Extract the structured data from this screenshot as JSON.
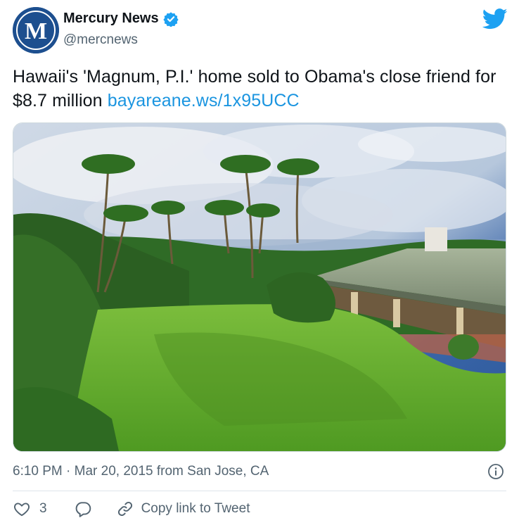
{
  "author": {
    "display_name": "Mercury News",
    "handle": "@mercnews",
    "verified": true,
    "avatar_icon": "mercury-news-logo-icon"
  },
  "tweet": {
    "text": "Hawaii's 'Magnum, P.I.' home sold to Obama's close friend for $8.7 million ",
    "link": "bayareane.ws/1x95UCC"
  },
  "photo": {
    "icon": "tropical-estate-photo"
  },
  "meta": {
    "timestamp": "6:10 PM · Mar 20, 2015 from San Jose, CA"
  },
  "actions": {
    "like_count": "3",
    "copy_label": "Copy link to Tweet"
  },
  "colors": {
    "link": "#1b95e0",
    "twitter_blue": "#1da1f2",
    "muted": "#536471"
  }
}
